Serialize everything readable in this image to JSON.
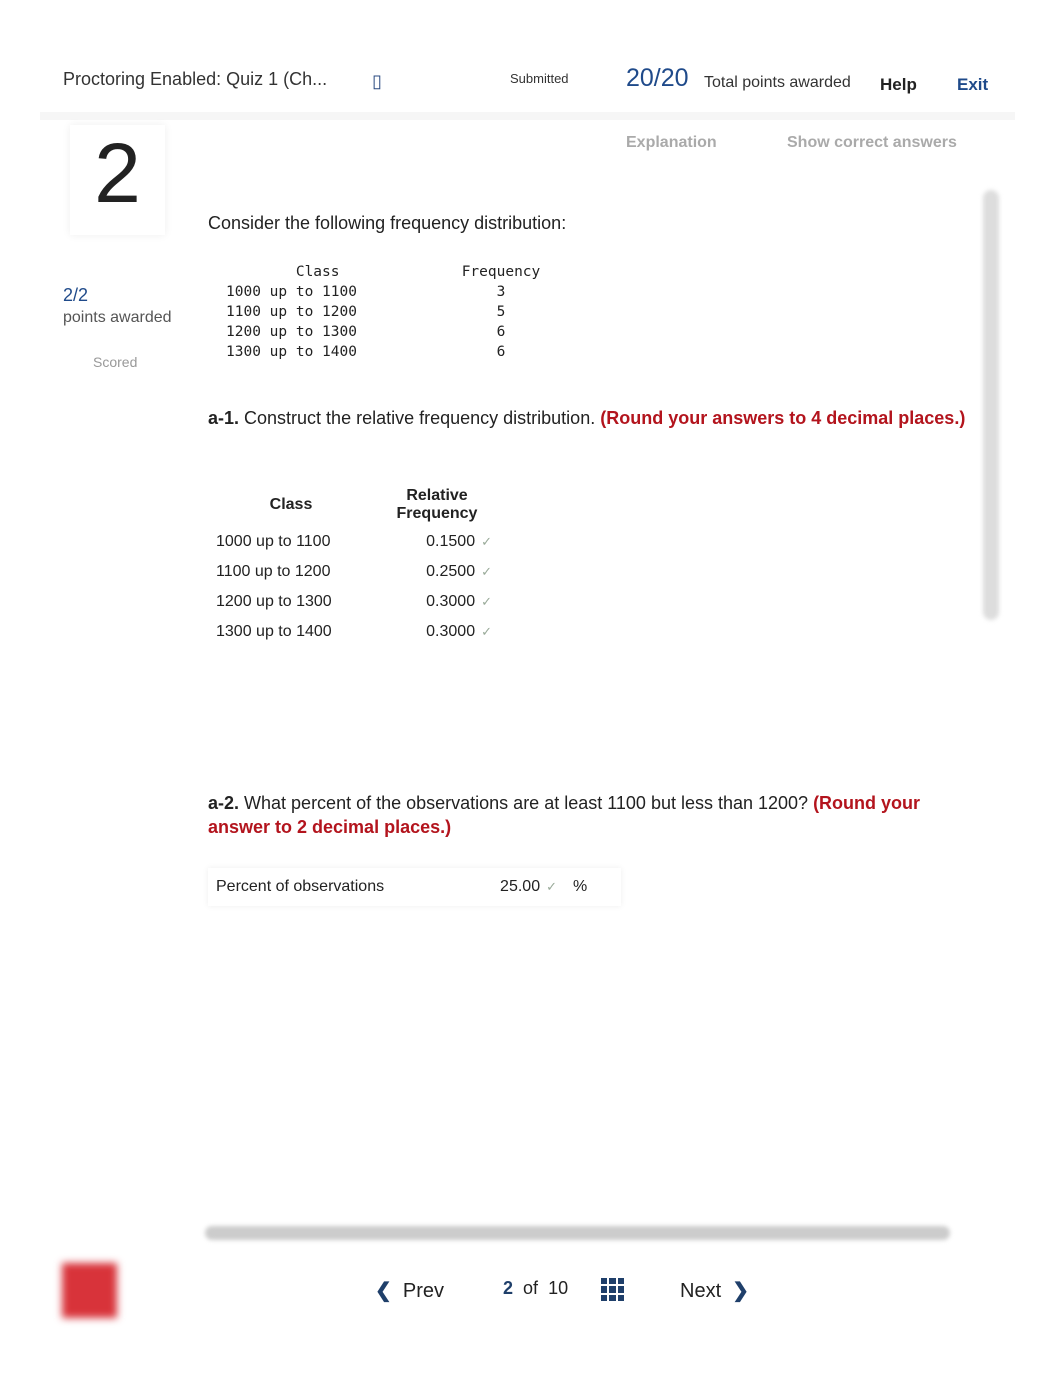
{
  "header": {
    "title": "Proctoring Enabled: Quiz 1 (Ch...",
    "status": "Submitted",
    "score": "20/20",
    "score_label": "Total points awarded",
    "help": "Help",
    "exit": "Exit"
  },
  "sidebar": {
    "question_number": "2",
    "points": "2/2",
    "points_label": "points awarded",
    "scored": "Scored"
  },
  "tabs": {
    "explanation": "Explanation",
    "show_correct": "Show correct answers"
  },
  "question": {
    "intro": "Consider the following frequency distribution:",
    "dist_text": "        Class              Frequency\n1000 up to 1100                3\n1100 up to 1200                5\n1200 up to 1300                6\n1300 up to 1400                6",
    "a1_label": "a-1.",
    "a1_text": " Construct the relative frequency distribution. ",
    "a1_note": "(Round your answers to 4 decimal places.)",
    "table_headers": [
      "Class",
      "Relative Frequency"
    ],
    "rows": [
      {
        "class": "1000 up to 1100",
        "value": "0.1500"
      },
      {
        "class": "1100 up to 1200",
        "value": "0.2500"
      },
      {
        "class": "1200 up to 1300",
        "value": "0.3000"
      },
      {
        "class": "1300 up to 1400",
        "value": "0.3000"
      }
    ],
    "a2_label": "a-2.",
    "a2_text": " What percent of the observations are at least 1100 but less than 1200? ",
    "a2_note": "(Round your answer to 2 decimal places.)",
    "a2_field_label": "Percent of observations",
    "a2_value": "25.00",
    "a2_unit": "%"
  },
  "footer": {
    "prev": "Prev",
    "current": "2",
    "of": "of",
    "total": "10",
    "next": "Next"
  }
}
